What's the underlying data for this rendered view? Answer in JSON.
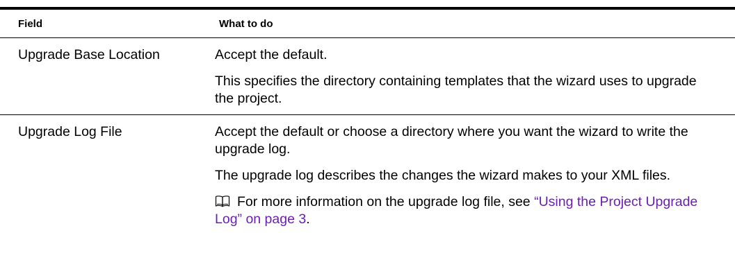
{
  "table": {
    "header": {
      "field": "Field",
      "what_to_do": "What to do"
    },
    "rows": [
      {
        "field": "Upgrade Base Location",
        "paragraphs": [
          "Accept the default.",
          "This specifies the directory containing templates that the wizard uses to upgrade the project."
        ]
      },
      {
        "field": "Upgrade Log File",
        "paragraphs": [
          "Accept the default or choose a directory where you want the wizard to write the upgrade log.",
          "The upgrade log describes the changes the wizard makes to your XML files."
        ],
        "note": {
          "icon": "book-icon",
          "text_before": "For more information on the upgrade log file, see ",
          "link_text": "“Using the Project Upgrade Log” on page 3",
          "text_after": "."
        }
      }
    ]
  },
  "colors": {
    "link": "#6a1fb5",
    "rule": "#000000"
  }
}
